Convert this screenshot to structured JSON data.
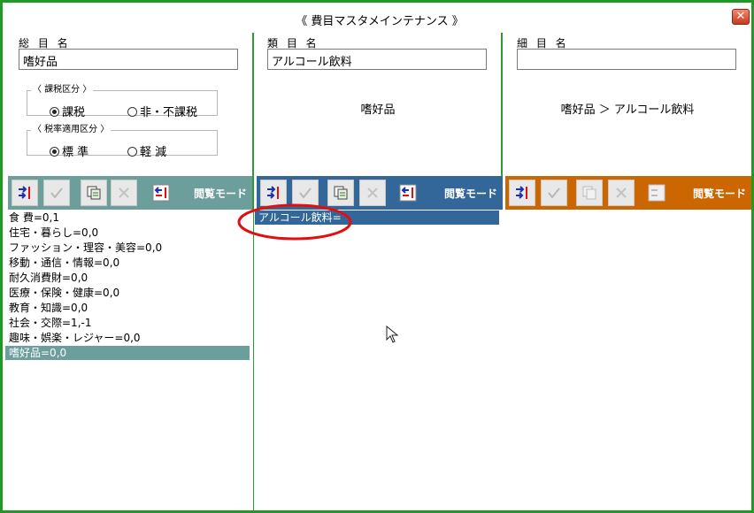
{
  "window": {
    "title": "《 費目マスタメインテナンス 》",
    "close_label": "✕"
  },
  "colors": {
    "frame": "#1f9a24",
    "col1": "#6c9e9c",
    "col2": "#336699",
    "col3": "#cc6600"
  },
  "col1": {
    "label": "総 目 名",
    "value": "嗜好品",
    "tax_group": {
      "legend": "〈 課税区分 〉",
      "options": [
        "課税",
        "非・不課税"
      ],
      "selected": "課税"
    },
    "rate_group": {
      "legend": "〈 税率適用区分 〉",
      "options": [
        "標 準",
        "軽 減"
      ],
      "selected": "標 準"
    },
    "mode_label": "閲覧モード",
    "items": [
      "食 費=0,1",
      "住宅・暮らし=0,0",
      "ファッション・理容・美容=0,0",
      "移動・通信・情報=0,0",
      "耐久消費財=0,0",
      "医療・保険・健康=0,0",
      "教育・知識=0,0",
      "社会・交際=1,-1",
      "趣味・娯楽・レジャー=0,0",
      "嗜好品=0,0"
    ],
    "selected_index": 9
  },
  "col2": {
    "label": "類 目 名",
    "value": "アルコール飲料",
    "breadcrumb": "嗜好品",
    "mode_label": "閲覧モード",
    "items": [
      "アルコール飲料="
    ],
    "selected_index": 0
  },
  "col3": {
    "label": "細 目 名",
    "value": "",
    "breadcrumb": "嗜好品 ＞ アルコール飲料",
    "mode_label": "閲覧モード",
    "items": []
  },
  "icons": [
    "move-icon",
    "check-icon",
    "copy-icon",
    "delete-icon",
    "sort-icon",
    "close-icon",
    "mouse-cursor-icon"
  ]
}
